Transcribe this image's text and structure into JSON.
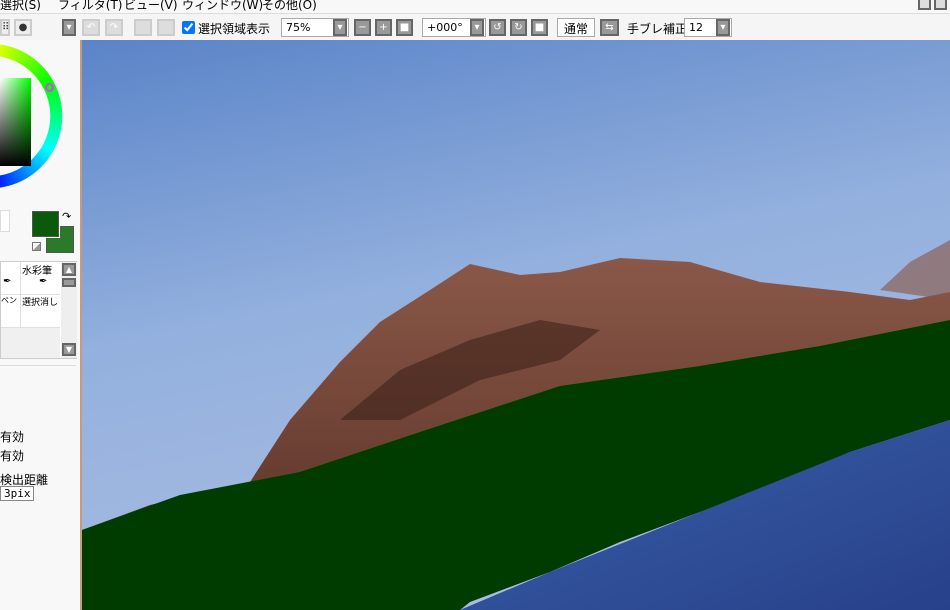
{
  "menu": [
    "選択(S)",
    "フィルタ(T)",
    "ビュー(V)",
    "ウィンドウ(W)",
    "その他(O)"
  ],
  "toolbar": {
    "selection_display": "選択領域表示",
    "selection_checked": true,
    "zoom": "75%",
    "rotation": "+000°",
    "blend_mode": "通常",
    "stabilizer_label": "手ブレ補正",
    "stabilizer_value": "12"
  },
  "colors": {
    "primary": "#0b5a0b",
    "secondary": "#2a7a2a",
    "sky_top": "#5a84c8",
    "mountain": "#7a4e3e",
    "grass": "#003c00",
    "water": "#2e4c98"
  },
  "tools": {
    "watercolor": "水彩筆",
    "pen_partial": "ペン",
    "select_erase": "選択消し"
  },
  "options": {
    "enabled1": "有効",
    "enabled2": "有効",
    "detect_distance_label": "検出距離",
    "detect_distance_value": "3pix"
  }
}
